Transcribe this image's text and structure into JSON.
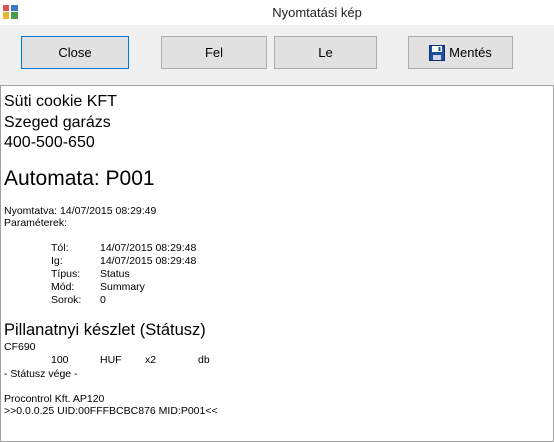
{
  "window": {
    "title": "Nyomtatási kép"
  },
  "toolbar": {
    "close_label": "Close",
    "up_label": "Fel",
    "down_label": "Le",
    "save_label": "Mentés"
  },
  "report": {
    "company": "Süti cookie KFT",
    "location": "Szeged garázs",
    "phone": "400-500-650",
    "machine": "Automata: P001",
    "printed": "Nyomtatva: 14/07/2015 08:29:49",
    "params_label": "Paraméterek:",
    "params": [
      {
        "label": "Tól:",
        "value": "14/07/2015 08:29:48"
      },
      {
        "label": "Ig:",
        "value": "14/07/2015 08:29:48"
      },
      {
        "label": "Típus:",
        "value": "Status"
      },
      {
        "label": "Mód:",
        "value": "Summary"
      },
      {
        "label": "Sorok:",
        "value": "0"
      }
    ],
    "section_title": "Pillanatnyi készlet (Státusz)",
    "section_code": "CF690",
    "stock_row": {
      "amount": "100",
      "currency": "HUF",
      "multiplier": "x2",
      "unit": "db"
    },
    "section_end": "- Státusz vége -",
    "footer_company": "Procontrol Kft. AP120",
    "footer_ids": ">>0.0.0.25 UID:00FFFBCBC876 MID:P001<<"
  }
}
